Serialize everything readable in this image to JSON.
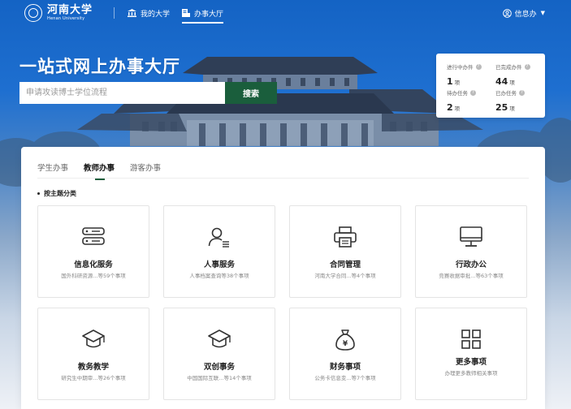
{
  "brand": {
    "name_cn": "河南大学",
    "name_en": "Henan University"
  },
  "nav": {
    "items": [
      {
        "label": "我的大学",
        "icon": "building-icon"
      },
      {
        "label": "办事大厅",
        "icon": "document-icon",
        "active": true
      }
    ],
    "user": {
      "label": "信息办",
      "icon": "user-circle-icon"
    }
  },
  "hero": {
    "title": "一站式网上办事大厅",
    "search_placeholder": "申请攻读博士学位流程",
    "search_button": "搜索"
  },
  "stats": [
    {
      "label": "进行中办件",
      "value": "1",
      "unit": "项"
    },
    {
      "label": "已完成办件",
      "value": "44",
      "unit": "项"
    },
    {
      "label": "待办任务",
      "value": "2",
      "unit": "项"
    },
    {
      "label": "已办任务",
      "value": "25",
      "unit": "项"
    }
  ],
  "tabs": [
    {
      "label": "学生办事"
    },
    {
      "label": "教师办事",
      "active": true
    },
    {
      "label": "游客办事"
    }
  ],
  "section_title": "按主题分类",
  "cards": [
    {
      "title": "信息化服务",
      "desc": "国外科研资源...等59个事项",
      "icon": "server-icon"
    },
    {
      "title": "人事服务",
      "desc": "人事档案查询等38个事项",
      "icon": "person-list-icon"
    },
    {
      "title": "合同管理",
      "desc": "河南大学合同...等4个事项",
      "icon": "printer-icon"
    },
    {
      "title": "行政办公",
      "desc": "竞赛收据审批...等63个事项",
      "icon": "monitor-icon"
    },
    {
      "title": "教务教学",
      "desc": "研究生中期审...等26个事项",
      "icon": "graduation-cap-icon"
    },
    {
      "title": "双创事务",
      "desc": "中国国际互联...等14个事项",
      "icon": "graduation-cap-icon"
    },
    {
      "title": "财务事项",
      "desc": "公务卡信息变...等7个事项",
      "icon": "money-bag-icon"
    },
    {
      "title": "更多事项",
      "desc": "办理更多教师相关事项",
      "icon": "grid-icon"
    }
  ],
  "colors": {
    "primary_green": "#1a5e3c",
    "hero_blue": "#1463c4"
  }
}
